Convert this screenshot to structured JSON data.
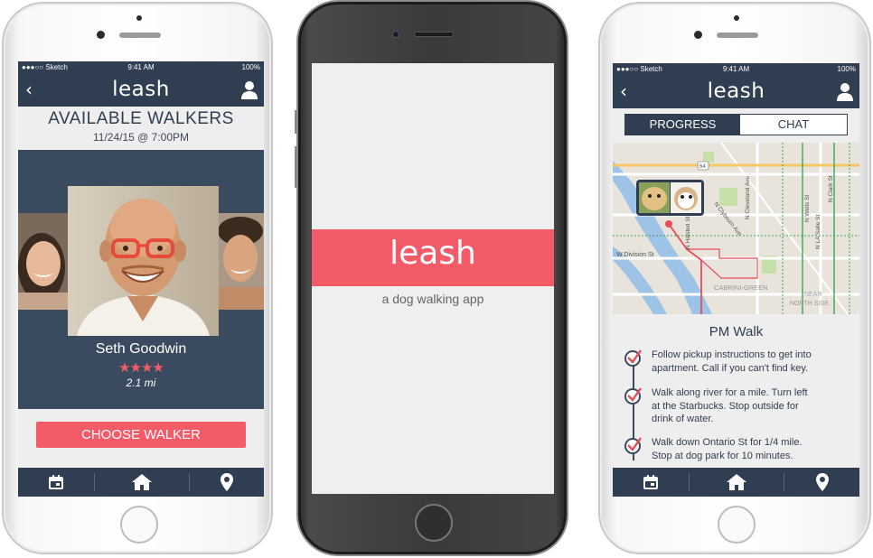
{
  "colors": {
    "navy": "#2f3e51",
    "coral": "#f35b68",
    "screen_bg": "#eeeeee"
  },
  "status_bar": {
    "carrier": "●●●○○ Sketch",
    "time": "9:41 AM",
    "battery": "100%"
  },
  "brand": {
    "logo": "leash"
  },
  "screen1": {
    "title": "AVAILABLE WALKERS",
    "date": "11/24/15 @ 7:00PM",
    "walker_name": "Seth Goodwin",
    "rating_stars": "★★★★",
    "rating": 4,
    "distance": "2.1 mi",
    "choose_button": "CHOOSE WALKER"
  },
  "screen2": {
    "logo": "leash",
    "tagline": "a dog walking app"
  },
  "screen3": {
    "tabs": [
      {
        "label": "PROGRESS",
        "selected": true
      },
      {
        "label": "CHAT",
        "selected": false
      }
    ],
    "map_labels": {
      "division": "W Division St",
      "clybourn": "N Clybourn Ave",
      "cleveland": "N Cleveland Ave",
      "halsted": "N Halsted St",
      "wells": "N Wells St",
      "lasalle": "N LA Salle St",
      "clark": "N Clark St",
      "cabrini": "CABRINI-GREEN",
      "near_north_1": "NEAR",
      "near_north_2": "NORTH SIDE",
      "route_shield": "64"
    },
    "walk_title": "PM Walk",
    "steps": [
      {
        "line1": "Follow pickup instructions to get into",
        "line2": "apartment.  Call if you can't find key.",
        "line3": ""
      },
      {
        "line1": "Walk along river for a mile. Turn left",
        "line2": "at the Starbucks.  Stop outside for",
        "line3": "drink of water."
      },
      {
        "line1": "Walk down Ontario St for 1/4 mile.",
        "line2": "Stop at dog park for 10  minutes.",
        "line3": ""
      }
    ]
  },
  "tabbar": {
    "icons": [
      "calendar-icon",
      "home-icon",
      "location-pin-icon"
    ]
  }
}
